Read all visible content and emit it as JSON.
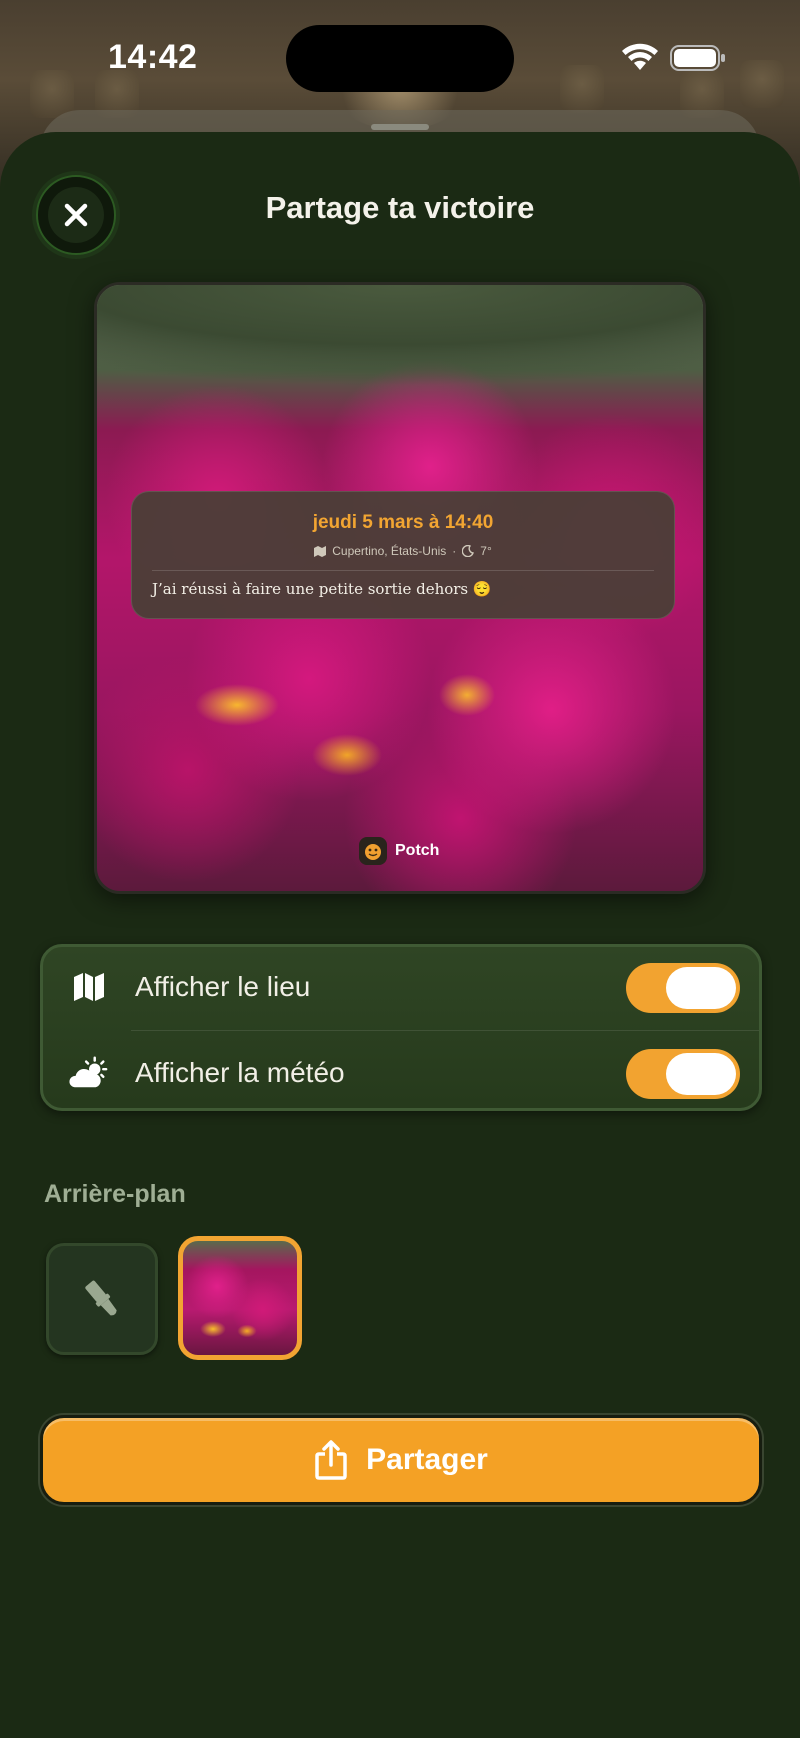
{
  "status_bar": {
    "time": "14:42"
  },
  "sheet": {
    "title": "Partage ta victoire"
  },
  "preview": {
    "date": "jeudi 5 mars à 14:40",
    "location": "Cupertino, États-Unis",
    "separator": "·",
    "weather": "7°",
    "note": "J’ai réussi à faire une petite sortie dehors 😌",
    "brand": "Potch"
  },
  "options": [
    {
      "label": "Afficher le lieu",
      "icon": "map-icon",
      "enabled": true
    },
    {
      "label": "Afficher la météo",
      "icon": "cloud-sun-icon",
      "enabled": true
    }
  ],
  "background": {
    "heading": "Arrière-plan",
    "options": [
      {
        "icon": "paintbrush-icon",
        "selected": false
      },
      {
        "icon": "photo-thumbnail",
        "selected": true
      }
    ]
  },
  "share": {
    "label": "Partager",
    "icon": "share-icon"
  },
  "colors": {
    "accent": "#f4a125",
    "sheet_bg": "#1b2a14",
    "card_bg": "#2f4524"
  }
}
